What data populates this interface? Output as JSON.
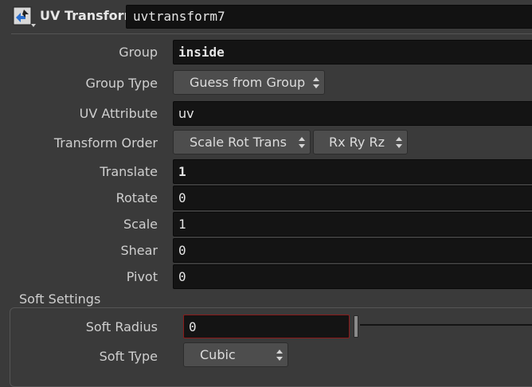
{
  "header": {
    "node_type": "UV Transform",
    "node_name": "uvtransform7",
    "icon": "uv-transform-node-icon"
  },
  "params": {
    "group": {
      "label": "Group",
      "value": "inside"
    },
    "group_type": {
      "label": "Group Type",
      "value": "Guess from Group"
    },
    "uv_attribute": {
      "label": "UV Attribute",
      "value": "uv"
    },
    "transform_order": {
      "label": "Transform Order",
      "order": "Scale Rot Trans",
      "rotation": "Rx Ry Rz"
    },
    "translate": {
      "label": "Translate",
      "value": "1"
    },
    "rotate": {
      "label": "Rotate",
      "value": "0"
    },
    "scale": {
      "label": "Scale",
      "value": "1"
    },
    "shear": {
      "label": "Shear",
      "value": "0"
    },
    "pivot": {
      "label": "Pivot",
      "value": "0"
    }
  },
  "soft_settings": {
    "title": "Soft Settings",
    "soft_radius": {
      "label": "Soft Radius",
      "value": "0"
    },
    "soft_type": {
      "label": "Soft Type",
      "value": "Cubic"
    }
  },
  "colors": {
    "background": "#3a3a3a",
    "field": "#141414",
    "highlight_border": "#8b1a1a"
  }
}
